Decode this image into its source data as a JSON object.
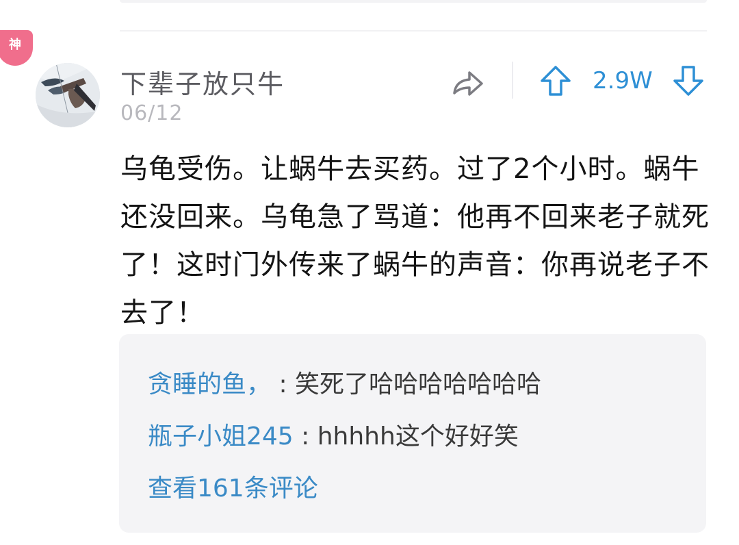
{
  "badge": {
    "label": "神"
  },
  "post": {
    "username": "下辈子放只牛",
    "date": "06/12",
    "content": "乌龟受伤。让蜗牛去买药。过了2个小时。蜗牛还没回来。乌龟急了骂道：他再不回来老子就死了！这时门外传来了蜗牛的声音：你再说老子不去了！",
    "vote_count": "2.9W"
  },
  "icons": {
    "share": "share-arrow-icon",
    "upvote": "arrow-up-icon",
    "downvote": "arrow-down-icon"
  },
  "comments": [
    {
      "author": "贪睡的鱼，",
      "sep": " : ",
      "text": "笑死了哈哈哈哈哈哈哈"
    },
    {
      "author": "瓶子小姐245",
      "sep": " : ",
      "text": "hhhhh这个好好笑"
    }
  ],
  "view_all_comments": "查看161条评论",
  "colors": {
    "accent": "#2d8fd5",
    "link": "#3a8ac6",
    "badge": "#f06e8c",
    "comment_bg": "#f4f4f6"
  }
}
